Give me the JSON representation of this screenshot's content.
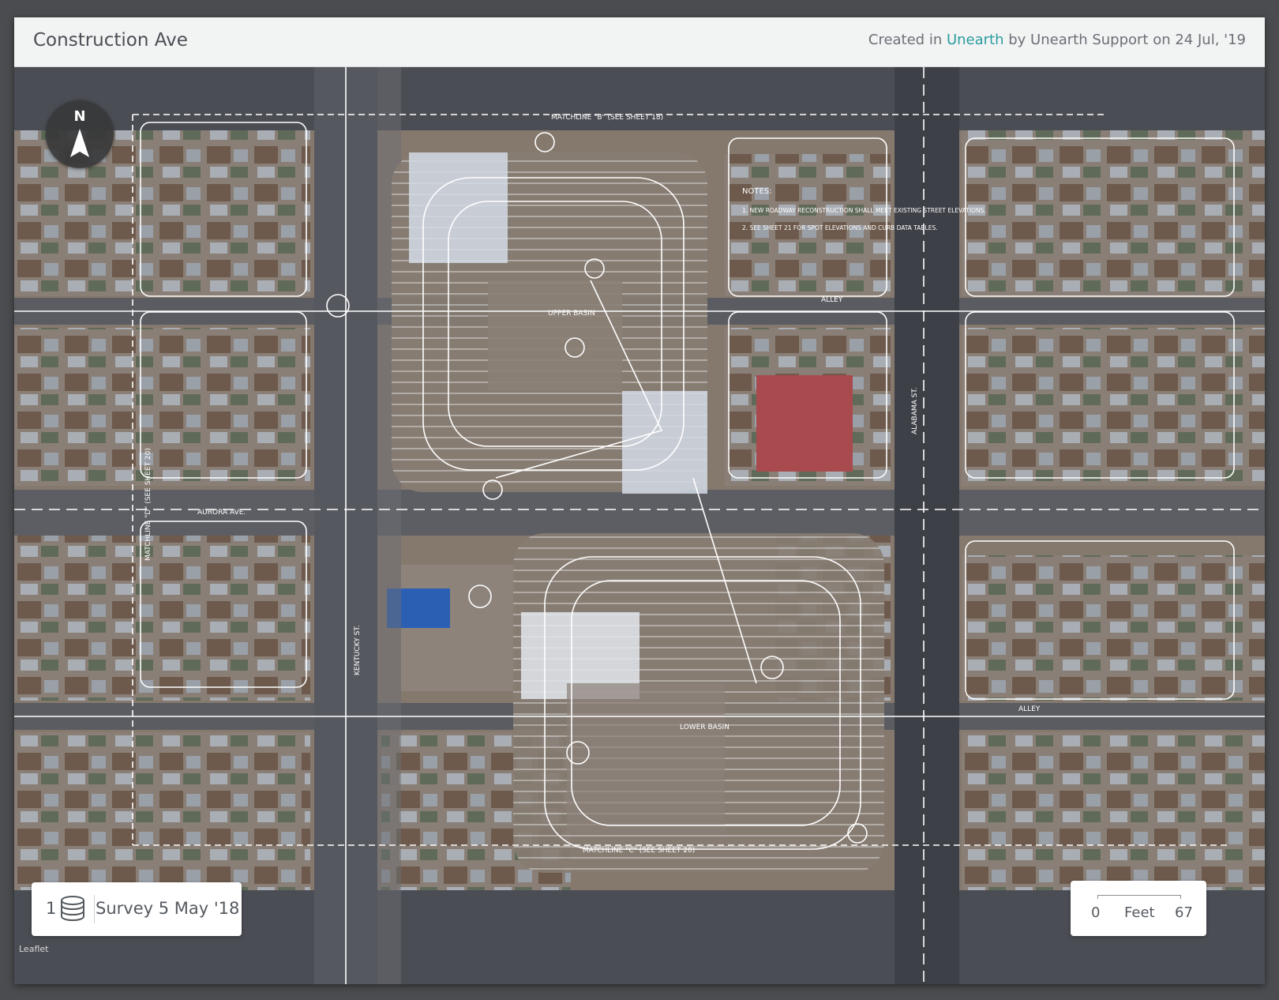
{
  "header": {
    "title": "Construction Ave",
    "credit_prefix": "Created in ",
    "credit_app": "Unearth",
    "credit_suffix": " by Unearth Support on 24 Jul, '19"
  },
  "compass": {
    "label": "N",
    "icon": "north-arrow-icon"
  },
  "survey": {
    "count": "1",
    "icon": "layers-stack-icon",
    "label": "Survey 5 May '18"
  },
  "scale": {
    "zero": "0",
    "unit": "Feet",
    "max": "67"
  },
  "attribution": "Leaflet",
  "plan_labels": {
    "matchline_top": "MATCHLINE \"B\" (SEE SHEET 18)",
    "matchline_bottom": "MATCHLINE \"C\" (SEE SHEET 20)",
    "matchline_left": "MATCHLINE \"D\" (SEE SHEET 20)",
    "aurora": "AURORA AVE.",
    "kentucky": "KENTUCKY ST.",
    "alabama": "ALABAMA ST.",
    "alley_top": "ALLEY",
    "alley_bottom": "ALLEY",
    "upper_basin": "UPPER BASIN",
    "lower_basin": "LOWER BASIN",
    "notes_title": "NOTES:",
    "note1": "1. NEW ROADWAY RECONSTRUCTION SHALL MEET EXISTING STREET ELEVATIONS.",
    "note2": "2. SEE SHEET 21 FOR SPOT ELEVATIONS AND CURB DATA TABLES."
  },
  "colors": {
    "accent": "#2a9d9f",
    "header_bg": "#f2f3f3",
    "frame": "#4a4c4f"
  }
}
